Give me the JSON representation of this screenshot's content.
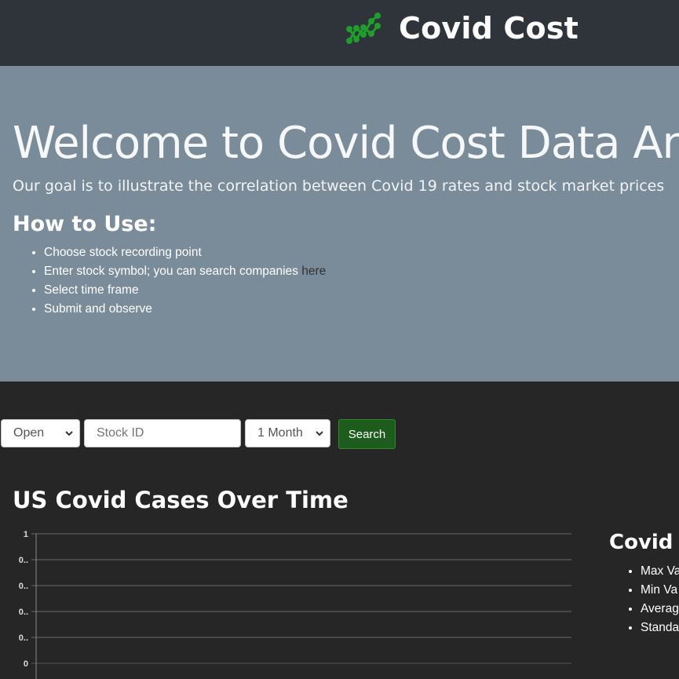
{
  "navbar": {
    "brand_title": "Covid Cost",
    "logo_icon": "chart-line-icon",
    "logo_color": "#1e9e2a"
  },
  "hero": {
    "heading": "Welcome to Covid Cost Data Analysis",
    "lead": "Our goal is to illustrate the correlation between Covid 19 rates and stock market prices",
    "how_to_title": "How to Use:",
    "steps": [
      "Choose stock recording point",
      "Enter stock symbol; you can search companies ",
      "Select time frame",
      "Submit and observe"
    ],
    "search_link_label": "here",
    "background_color": "#7a8b99"
  },
  "form": {
    "recording_point_selected": "Open",
    "stock_id_placeholder": "Stock ID",
    "stock_id_value": "",
    "time_frame_selected": "1 Month",
    "search_label": "Search",
    "search_color": "#1e5c1e"
  },
  "chart_section": {
    "title": "US Covid Cases Over Time"
  },
  "chart_data": {
    "type": "line",
    "title": "US Covid Cases Over Time",
    "y_tick_labels": [
      "1",
      "0..",
      "0..",
      "0..",
      "0..",
      "0"
    ],
    "ylim": [
      0,
      1
    ],
    "series": [],
    "grid": true,
    "xlabel": "",
    "ylabel": ""
  },
  "stats": {
    "title": "Covid C",
    "items": [
      "Max Va",
      "Min Va",
      "Averag",
      "Standa"
    ]
  }
}
